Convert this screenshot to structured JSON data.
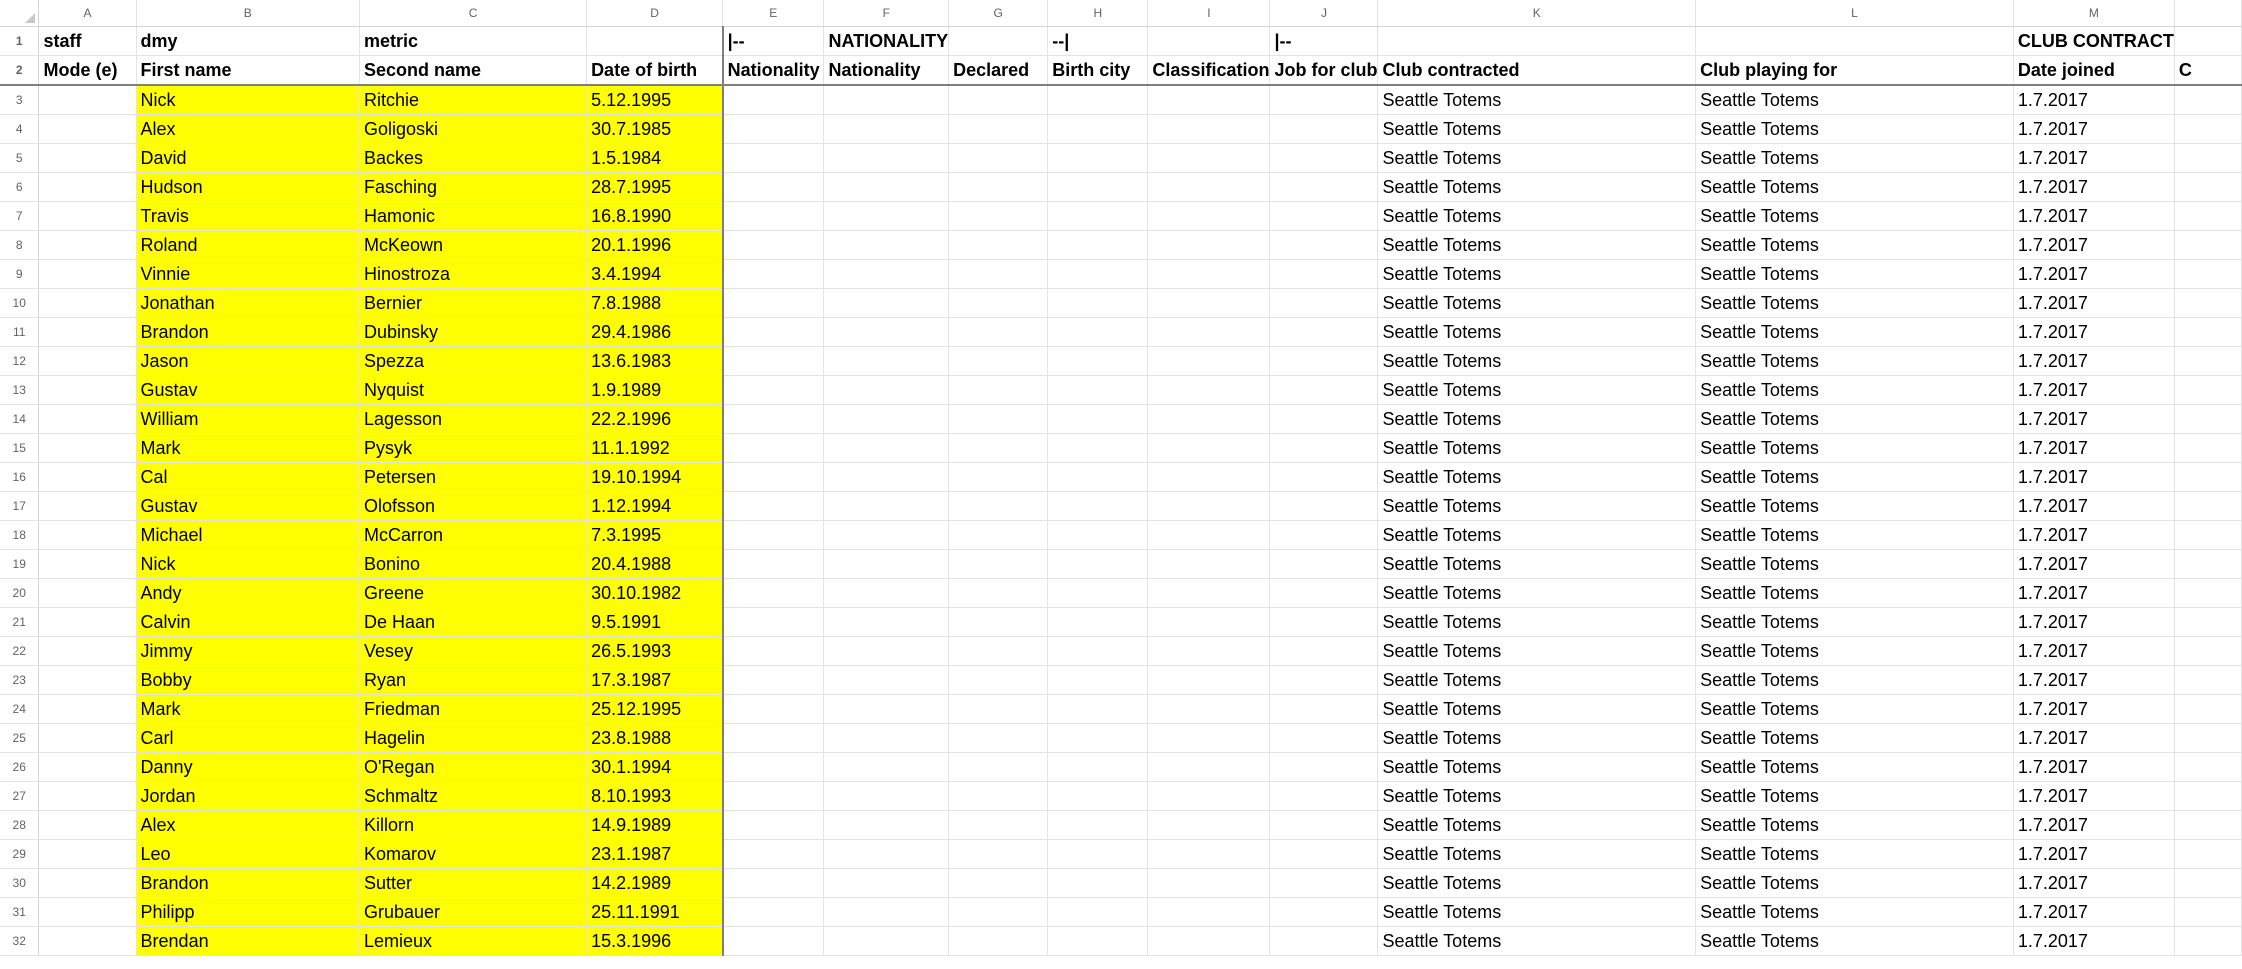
{
  "col_letters": [
    "A",
    "B",
    "C",
    "D",
    "E",
    "F",
    "G",
    "H",
    "I",
    "J",
    "K",
    "L",
    "M"
  ],
  "header1": {
    "a": "staff",
    "b": "dmy",
    "c": "metric",
    "d": "",
    "e": "|--",
    "f": "NATIONALITY",
    "g": "",
    "h": "--|",
    "i": "",
    "j": "|--",
    "k": "",
    "l": "",
    "m": "CLUB CONTRACT"
  },
  "header2": {
    "a": "Mode (e)",
    "b": "First name",
    "c": "Second name",
    "d": "Date of birth",
    "e": "Nationality",
    "f": "Nationality",
    "g": "Declared",
    "h": "Birth city",
    "i": "Classification",
    "j": "Job for club",
    "k": "Club contracted",
    "l": "Club playing for",
    "m": "Date joined",
    "n": "C"
  },
  "rows": [
    {
      "n": "3",
      "first": "Nick",
      "last": "Ritchie",
      "dob": "5.12.1995",
      "club": "Seattle Totems",
      "playing": "Seattle Totems",
      "joined": "1.7.2017"
    },
    {
      "n": "4",
      "first": "Alex",
      "last": "Goligoski",
      "dob": "30.7.1985",
      "club": "Seattle Totems",
      "playing": "Seattle Totems",
      "joined": "1.7.2017"
    },
    {
      "n": "5",
      "first": "David",
      "last": "Backes",
      "dob": "1.5.1984",
      "club": "Seattle Totems",
      "playing": "Seattle Totems",
      "joined": "1.7.2017"
    },
    {
      "n": "6",
      "first": "Hudson",
      "last": "Fasching",
      "dob": "28.7.1995",
      "club": "Seattle Totems",
      "playing": "Seattle Totems",
      "joined": "1.7.2017"
    },
    {
      "n": "7",
      "first": "Travis",
      "last": "Hamonic",
      "dob": "16.8.1990",
      "club": "Seattle Totems",
      "playing": "Seattle Totems",
      "joined": "1.7.2017"
    },
    {
      "n": "8",
      "first": "Roland",
      "last": "McKeown",
      "dob": "20.1.1996",
      "club": "Seattle Totems",
      "playing": "Seattle Totems",
      "joined": "1.7.2017"
    },
    {
      "n": "9",
      "first": "Vinnie",
      "last": "Hinostroza",
      "dob": "3.4.1994",
      "club": "Seattle Totems",
      "playing": "Seattle Totems",
      "joined": "1.7.2017"
    },
    {
      "n": "10",
      "first": "Jonathan",
      "last": "Bernier",
      "dob": "7.8.1988",
      "club": "Seattle Totems",
      "playing": "Seattle Totems",
      "joined": "1.7.2017"
    },
    {
      "n": "11",
      "first": "Brandon",
      "last": "Dubinsky",
      "dob": "29.4.1986",
      "club": "Seattle Totems",
      "playing": "Seattle Totems",
      "joined": "1.7.2017"
    },
    {
      "n": "12",
      "first": "Jason",
      "last": "Spezza",
      "dob": "13.6.1983",
      "club": "Seattle Totems",
      "playing": "Seattle Totems",
      "joined": "1.7.2017"
    },
    {
      "n": "13",
      "first": "Gustav",
      "last": "Nyquist",
      "dob": "1.9.1989",
      "club": "Seattle Totems",
      "playing": "Seattle Totems",
      "joined": "1.7.2017"
    },
    {
      "n": "14",
      "first": "William",
      "last": "Lagesson",
      "dob": "22.2.1996",
      "club": "Seattle Totems",
      "playing": "Seattle Totems",
      "joined": "1.7.2017"
    },
    {
      "n": "15",
      "first": "Mark",
      "last": "Pysyk",
      "dob": "11.1.1992",
      "club": "Seattle Totems",
      "playing": "Seattle Totems",
      "joined": "1.7.2017"
    },
    {
      "n": "16",
      "first": "Cal",
      "last": "Petersen",
      "dob": "19.10.1994",
      "club": "Seattle Totems",
      "playing": "Seattle Totems",
      "joined": "1.7.2017"
    },
    {
      "n": "17",
      "first": "Gustav",
      "last": "Olofsson",
      "dob": "1.12.1994",
      "club": "Seattle Totems",
      "playing": "Seattle Totems",
      "joined": "1.7.2017"
    },
    {
      "n": "18",
      "first": "Michael",
      "last": "McCarron",
      "dob": "7.3.1995",
      "club": "Seattle Totems",
      "playing": "Seattle Totems",
      "joined": "1.7.2017"
    },
    {
      "n": "19",
      "first": "Nick",
      "last": "Bonino",
      "dob": "20.4.1988",
      "club": "Seattle Totems",
      "playing": "Seattle Totems",
      "joined": "1.7.2017"
    },
    {
      "n": "20",
      "first": "Andy",
      "last": "Greene",
      "dob": "30.10.1982",
      "club": "Seattle Totems",
      "playing": "Seattle Totems",
      "joined": "1.7.2017"
    },
    {
      "n": "21",
      "first": "Calvin",
      "last": "De Haan",
      "dob": "9.5.1991",
      "club": "Seattle Totems",
      "playing": "Seattle Totems",
      "joined": "1.7.2017"
    },
    {
      "n": "22",
      "first": "Jimmy",
      "last": "Vesey",
      "dob": "26.5.1993",
      "club": "Seattle Totems",
      "playing": "Seattle Totems",
      "joined": "1.7.2017"
    },
    {
      "n": "23",
      "first": "Bobby",
      "last": "Ryan",
      "dob": "17.3.1987",
      "club": "Seattle Totems",
      "playing": "Seattle Totems",
      "joined": "1.7.2017"
    },
    {
      "n": "24",
      "first": "Mark",
      "last": "Friedman",
      "dob": "25.12.1995",
      "club": "Seattle Totems",
      "playing": "Seattle Totems",
      "joined": "1.7.2017"
    },
    {
      "n": "25",
      "first": "Carl",
      "last": "Hagelin",
      "dob": "23.8.1988",
      "club": "Seattle Totems",
      "playing": "Seattle Totems",
      "joined": "1.7.2017"
    },
    {
      "n": "26",
      "first": "Danny",
      "last": "O'Regan",
      "dob": "30.1.1994",
      "club": "Seattle Totems",
      "playing": "Seattle Totems",
      "joined": "1.7.2017"
    },
    {
      "n": "27",
      "first": "Jordan",
      "last": "Schmaltz",
      "dob": "8.10.1993",
      "club": "Seattle Totems",
      "playing": "Seattle Totems",
      "joined": "1.7.2017"
    },
    {
      "n": "28",
      "first": "Alex",
      "last": "Killorn",
      "dob": "14.9.1989",
      "club": "Seattle Totems",
      "playing": "Seattle Totems",
      "joined": "1.7.2017"
    },
    {
      "n": "29",
      "first": "Leo",
      "last": "Komarov",
      "dob": "23.1.1987",
      "club": "Seattle Totems",
      "playing": "Seattle Totems",
      "joined": "1.7.2017"
    },
    {
      "n": "30",
      "first": "Brandon",
      "last": "Sutter",
      "dob": "14.2.1989",
      "club": "Seattle Totems",
      "playing": "Seattle Totems",
      "joined": "1.7.2017"
    },
    {
      "n": "31",
      "first": "Philipp",
      "last": "Grubauer",
      "dob": "25.11.1991",
      "club": "Seattle Totems",
      "playing": "Seattle Totems",
      "joined": "1.7.2017"
    },
    {
      "n": "32",
      "first": "Brendan",
      "last": "Lemieux",
      "dob": "15.3.1996",
      "club": "Seattle Totems",
      "playing": "Seattle Totems",
      "joined": "1.7.2017"
    }
  ],
  "colors": {
    "highlight": "#ffff00",
    "gridline": "#e3e3e3",
    "header_text": "#5f6368"
  }
}
